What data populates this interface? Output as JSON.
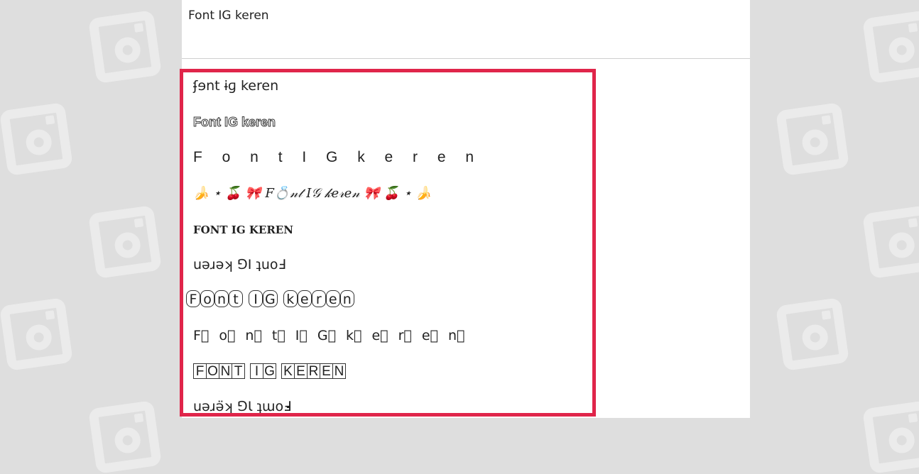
{
  "input": {
    "value": "Font IG keren"
  },
  "colors": {
    "highlight_border": "#e0254a",
    "background": "#dedede"
  },
  "background_icon": "instagram-icon",
  "results": [
    "ʄɘnt ɨɡ keren",
    "Font IG keren",
    "F o n t  I G k e r e n",
    "🍌 ⋆ 🍒 🎀 𝐹💍𝓃𝓉 𝐼𝒢 𝓀𝑒𝓇𝑒𝓃 🎀 🍒 ⋆ 🍌",
    "FONT IG KEREN",
    "uǝɹǝʞ ⅁I ʇuoℲ",
    "Font IG keren",
    "F⃣ o⃣ n⃣ t⃣  I⃣ G⃣  k⃣ e⃣ r⃣ e⃣ n⃣",
    "FONT IG KEREN",
    "uǝɹǝ̈ʞ ⅁Ɩ ʇɯoℲ̵"
  ]
}
